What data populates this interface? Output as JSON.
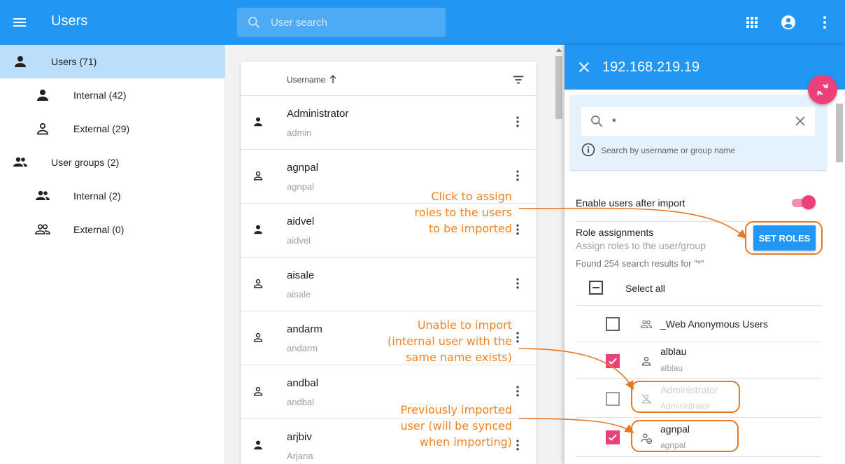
{
  "appbar": {
    "title": "Users",
    "search_placeholder": "User search"
  },
  "nav": {
    "items": [
      {
        "label": "Users (71)",
        "icon": "person-icon"
      },
      {
        "label": "Internal (42)",
        "icon": "person-icon"
      },
      {
        "label": "External (29)",
        "icon": "person-outline-icon"
      },
      {
        "label": "User groups (2)",
        "icon": "group-icon"
      },
      {
        "label": "Internal (2)",
        "icon": "group-icon"
      },
      {
        "label": "External (0)",
        "icon": "group-outline-icon"
      }
    ]
  },
  "users_table": {
    "column_header": "Username",
    "rows": [
      {
        "name": "Administrator",
        "login": "admin"
      },
      {
        "name": "agnpal",
        "login": "agnpal"
      },
      {
        "name": "aidvel",
        "login": "aidvel"
      },
      {
        "name": "aisale",
        "login": "aisale"
      },
      {
        "name": "andarm",
        "login": "andarm"
      },
      {
        "name": "andbal",
        "login": "andbal"
      },
      {
        "name": "arjbiv",
        "login": "Arjana"
      }
    ]
  },
  "import_panel": {
    "title": "192.168.219.19",
    "search_value": "*",
    "search_hint": "Search by username or group name",
    "enable_users_label": "Enable users after import",
    "enable_users_on": true,
    "role_assignments_label": "Role assignments",
    "role_assignments_sub": "Assign roles to the user/group",
    "set_roles_label": "SET ROLES",
    "found_text": "Found 254 search results for \"*\"",
    "select_all_label": "Select all",
    "items": [
      {
        "name": "_Web Anonymous Users",
        "login": "",
        "checked": false,
        "state": "group"
      },
      {
        "name": "alblau",
        "login": "alblau",
        "checked": true,
        "state": "new"
      },
      {
        "name": "Administrator",
        "login": "Administrator",
        "checked": false,
        "state": "conflict"
      },
      {
        "name": "agnpal",
        "login": "agnpal",
        "checked": true,
        "state": "imported"
      }
    ]
  },
  "annotations": {
    "set_roles": [
      "Click to assign",
      "roles to the users",
      "to be imported"
    ],
    "conflict": [
      "Unable to import",
      "(internal user with the",
      "same name exists)"
    ],
    "imported": [
      "Previously imported",
      "user (will be synced",
      "when importing)"
    ]
  },
  "colors": {
    "primary": "#2196f3",
    "accent": "#ec407a",
    "annotation": "#f5821f",
    "nav_active": "#bbdefb"
  }
}
